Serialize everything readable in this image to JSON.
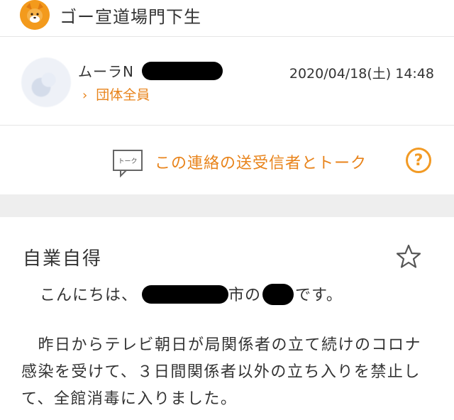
{
  "header": {
    "group_name": "ゴー宣道場門下生",
    "avatar_icon": "shiba-dog-icon"
  },
  "sender": {
    "name_prefix": "ムーラN",
    "date": "2020/04/18(土) 14:48",
    "group_link": "団体全員",
    "chevron_icon": "chevron-right-icon"
  },
  "talk": {
    "icon_text": "トーク",
    "label": "この連絡の送受信者とトーク",
    "help": "?"
  },
  "message": {
    "title": "自業自得",
    "greeting_start": "こんにちは、",
    "greeting_mid": "市の",
    "greeting_end": "です。",
    "paragraph": "　昨日からテレビ朝日が局関係者の立て続けのコロナ感染を受けて、３日間関係者以外の立ち入りを禁止して、全館消毒に入りました。"
  },
  "colors": {
    "accent": "#e8831a",
    "band": "#eeeeee",
    "text": "#333333"
  }
}
